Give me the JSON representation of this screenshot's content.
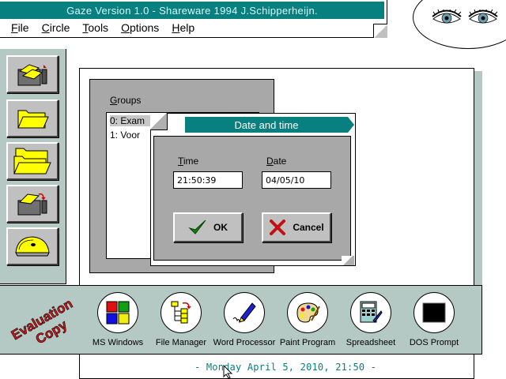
{
  "app": {
    "title": "Gaze Version 1.0 - Shareware 1994 J.Schipperheijn."
  },
  "menu": [
    {
      "label": "File",
      "accel": "F",
      "rest": "ile"
    },
    {
      "label": "Circle",
      "accel": "C",
      "rest": "ircle"
    },
    {
      "label": "Tools",
      "accel": "T",
      "rest": "ools"
    },
    {
      "label": "Options",
      "accel": "O",
      "rest": "ptions"
    },
    {
      "label": "Help",
      "accel": "H",
      "rest": "elp"
    }
  ],
  "toolbar": {
    "icons": [
      "open-cabinet-icon",
      "open-folder-icon",
      "folders-icon",
      "cabinet-arrow-icon",
      "disk-icon"
    ]
  },
  "groups": {
    "label": "Groups",
    "accel": "G",
    "rest": "roups",
    "items": [
      "0: Exam",
      "1: Voor"
    ]
  },
  "dialog": {
    "title": "Date and time",
    "time_label": "Time",
    "time_accel": "T",
    "time_rest": "ime",
    "time_value": "21:50:39",
    "date_label": "Date",
    "date_accel": "D",
    "date_rest": "ate",
    "date_value": "04/05/10",
    "ok_label": "OK",
    "cancel_label": "Cancel"
  },
  "stamp": {
    "line1": "Evaluation",
    "line2": "Copy"
  },
  "launcher": [
    {
      "label": "MS Windows",
      "icon": "windows-logo-icon"
    },
    {
      "label": "File Manager",
      "icon": "file-manager-icon"
    },
    {
      "label": "Word Processor",
      "icon": "pen-icon"
    },
    {
      "label": "Paint Program",
      "icon": "palette-icon"
    },
    {
      "label": "Spreadsheet",
      "icon": "calculator-icon"
    },
    {
      "label": "DOS Prompt",
      "icon": "dos-screen-icon"
    }
  ],
  "status": {
    "text": "- Monday April 5, 2010, 21:50 -"
  },
  "colors": {
    "teal": "#088080",
    "panel": "#b4c8c4",
    "gray": "#a8a8a8",
    "stamp_red": "#d81818"
  }
}
